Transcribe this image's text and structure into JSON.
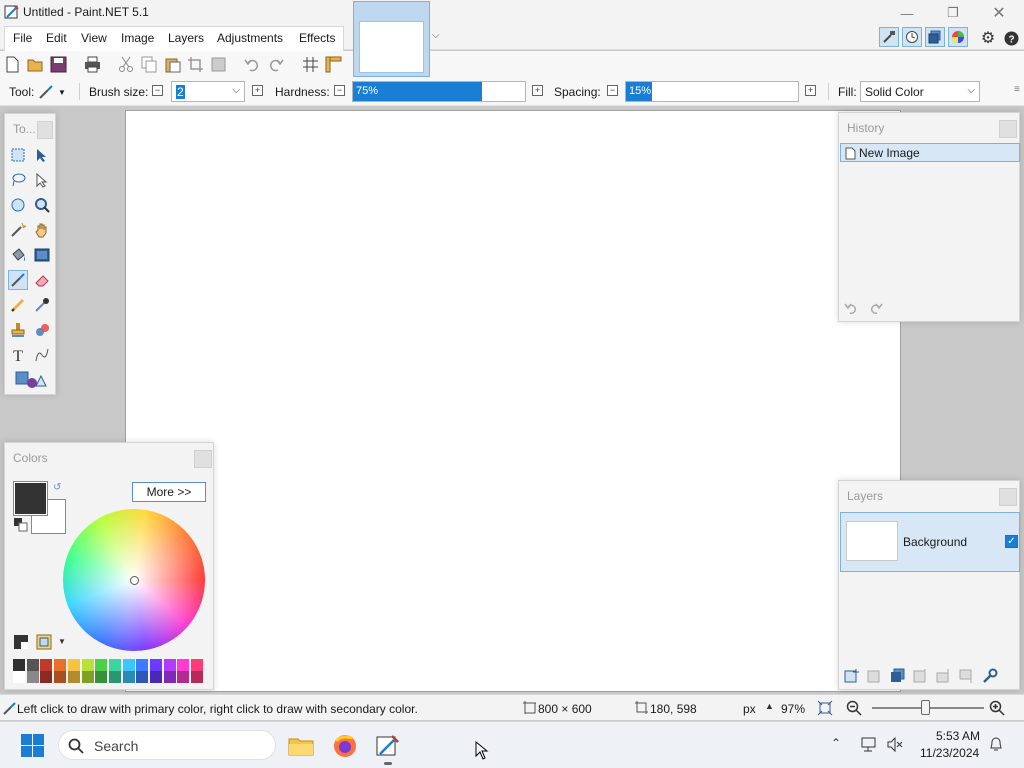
{
  "window": {
    "title": "Untitled - Paint.NET 5.1",
    "minimize_icon": "minimize-icon",
    "restore_icon": "restore-icon",
    "close_icon": "close-icon"
  },
  "menu": {
    "items": [
      "File",
      "Edit",
      "View",
      "Image",
      "Layers",
      "Adjustments",
      "Effects"
    ]
  },
  "toolbar": {
    "tool_label": "Tool:",
    "brush_size_label": "Brush size:",
    "brush_size_value": "2",
    "hardness_label": "Hardness:",
    "hardness_value": "75%",
    "hardness_fraction": 0.75,
    "spacing_label": "Spacing:",
    "spacing_value": "15%",
    "spacing_fraction": 0.15,
    "fill_label": "Fill:",
    "fill_value": "Solid Color",
    "minus_glyph": "−",
    "plus_glyph": "+"
  },
  "panels": {
    "tools": {
      "title": "To..."
    },
    "colors": {
      "title": "Colors",
      "more_button": "More >>",
      "primary": "#333333",
      "secondary": "#ffffff"
    },
    "history": {
      "title": "History",
      "items": [
        "New Image"
      ]
    },
    "layers": {
      "title": "Layers",
      "items": [
        {
          "name": "Background",
          "visible": true
        }
      ]
    }
  },
  "status": {
    "hint": "Left click to draw with primary color, right click to draw with secondary color.",
    "image_size": "800 × 600",
    "cursor_pos": "180, 598",
    "units": "px",
    "zoom": "97%"
  },
  "taskbar": {
    "search_placeholder": "Search",
    "time": "5:53 AM",
    "date": "11/23/2024"
  },
  "colors": {
    "accent": "#1a7fd4",
    "selection_bg": "#d7e7f6",
    "selection_border": "#7fb1dd"
  }
}
